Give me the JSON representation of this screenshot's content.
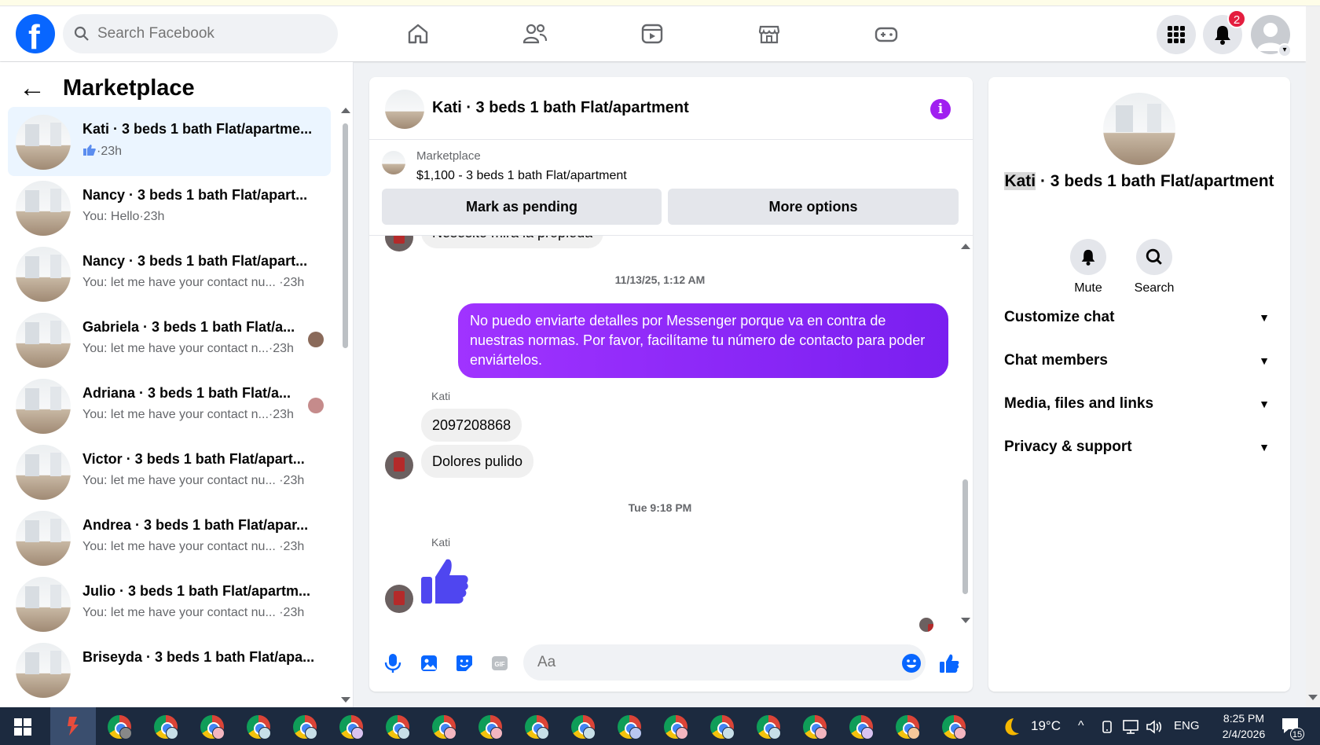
{
  "header": {
    "logo": "f",
    "search_placeholder": "Search Facebook",
    "notification_count": "2",
    "nav_icons": [
      "home-icon",
      "friends-icon",
      "video-icon",
      "marketplace-icon",
      "gaming-icon"
    ]
  },
  "sidebar": {
    "title": "Marketplace",
    "conversations": [
      {
        "name": "Kati · 3 beds 1 bath Flat/apartme...",
        "sub": "·23h",
        "active": true
      },
      {
        "name": "Nancy · 3 beds 1 bath Flat/apart...",
        "sub": "You: Hello·23h"
      },
      {
        "name": "Nancy · 3 beds 1 bath Flat/apart...",
        "sub": "You: let me have your contact nu... ·23h"
      },
      {
        "name": "Gabriela · 3 beds 1 bath Flat/a...",
        "sub": "You: let me have your contact n...·23h"
      },
      {
        "name": "Adriana · 3 beds 1 bath Flat/a...",
        "sub": "You: let me have your contact n...·23h"
      },
      {
        "name": "Victor · 3 beds 1 bath Flat/apart...",
        "sub": "You: let me have your contact nu... ·23h"
      },
      {
        "name": "Andrea · 3 beds 1 bath Flat/apar...",
        "sub": "You: let me have your contact nu... ·23h"
      },
      {
        "name": "Julio · 3 beds 1 bath Flat/apartm...",
        "sub": "You: let me have your contact nu... ·23h"
      },
      {
        "name": "Briseyda · 3 beds 1 bath Flat/apa...",
        "sub": ""
      }
    ]
  },
  "chat": {
    "title": "Kati · 3 beds 1 bath Flat/apartment",
    "marketplace_label": "Marketplace",
    "listing": "$1,100 - 3 beds 1 bath Flat/apartment",
    "mark_pending": "Mark as pending",
    "more_options": "More options",
    "cut_message": "Nesesito mira la propieda",
    "timestamp_1": "11/13/25, 1:12 AM",
    "outgoing_message": "No puedo enviarte detalles por Messenger porque va en contra de nuestras normas. Por favor, facilítame tu número de contacto para poder enviártelos.",
    "sender_1": "Kati",
    "incoming_1": "2097208868",
    "incoming_2": "Dolores pulido",
    "timestamp_2": "Tue 9:18 PM",
    "sender_2": "Kati",
    "composer_placeholder": "Aa"
  },
  "details": {
    "title_highlight": "Kati",
    "title_rest": " · 3 beds 1 bath Flat/apartment",
    "mute": "Mute",
    "search": "Search",
    "sections": [
      "Customize chat",
      "Chat members",
      "Media, files and links",
      "Privacy & support"
    ]
  },
  "taskbar": {
    "temperature": "19°C",
    "language": "ENG",
    "time": "8:25 PM",
    "date": "2/4/2026",
    "notifications": "15"
  },
  "colors": {
    "brand": "#0866ff",
    "outgoing_bubble": "#8a2bf5",
    "like": "#4f46f0"
  }
}
